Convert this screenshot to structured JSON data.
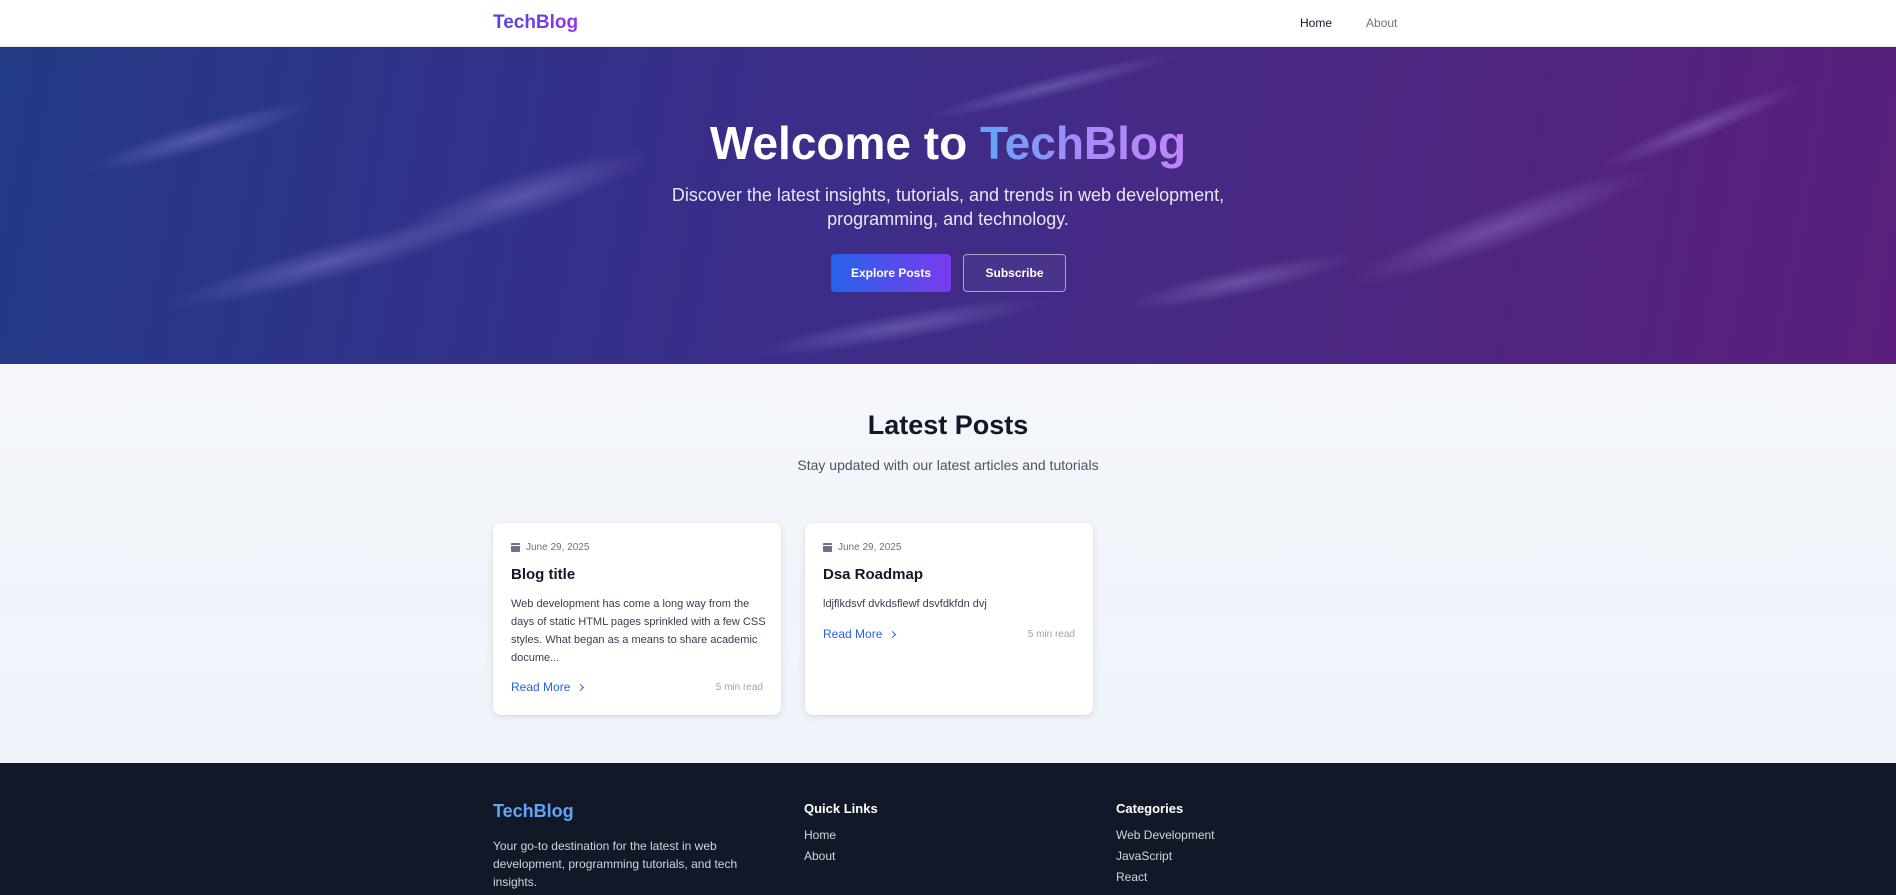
{
  "nav": {
    "logo": "TechBlog",
    "links": [
      {
        "label": "Home",
        "active": true
      },
      {
        "label": "About",
        "active": false
      }
    ]
  },
  "hero": {
    "title_prefix": "Welcome to ",
    "title_accent": "TechBlog",
    "subtitle": "Discover the latest insights, tutorials, and trends in web development, programming, and technology.",
    "primary_button": "Explore Posts",
    "secondary_button": "Subscribe"
  },
  "latest": {
    "title": "Latest Posts",
    "subtitle": "Stay updated with our latest articles and tutorials",
    "posts": [
      {
        "date": "June 29, 2025",
        "title": "Blog title",
        "excerpt": "Web development has come a long way from the days of static HTML pages sprinkled with a few CSS styles. What began as a means to share academic docume...",
        "read_more": "Read More",
        "read_time": "5 min read"
      },
      {
        "date": "June 29, 2025",
        "title": "Dsa Roadmap",
        "excerpt": "ldjflkdsvf dvkdsflewf dsvfdkfdn dvj",
        "read_more": "Read More",
        "read_time": "5 min read"
      }
    ]
  },
  "footer": {
    "brand": "TechBlog",
    "description": "Your go-to destination for the latest in web development, programming tutorials, and tech insights.",
    "quick_links": {
      "title": "Quick Links",
      "items": [
        "Home",
        "About"
      ]
    },
    "categories": {
      "title": "Categories",
      "items": [
        "Web Development",
        "JavaScript",
        "React"
      ]
    }
  },
  "colors": {
    "brand_gradient_start": "#2563eb",
    "brand_gradient_end": "#7c3aed",
    "link": "#2563eb",
    "footer_bg": "#111827"
  }
}
